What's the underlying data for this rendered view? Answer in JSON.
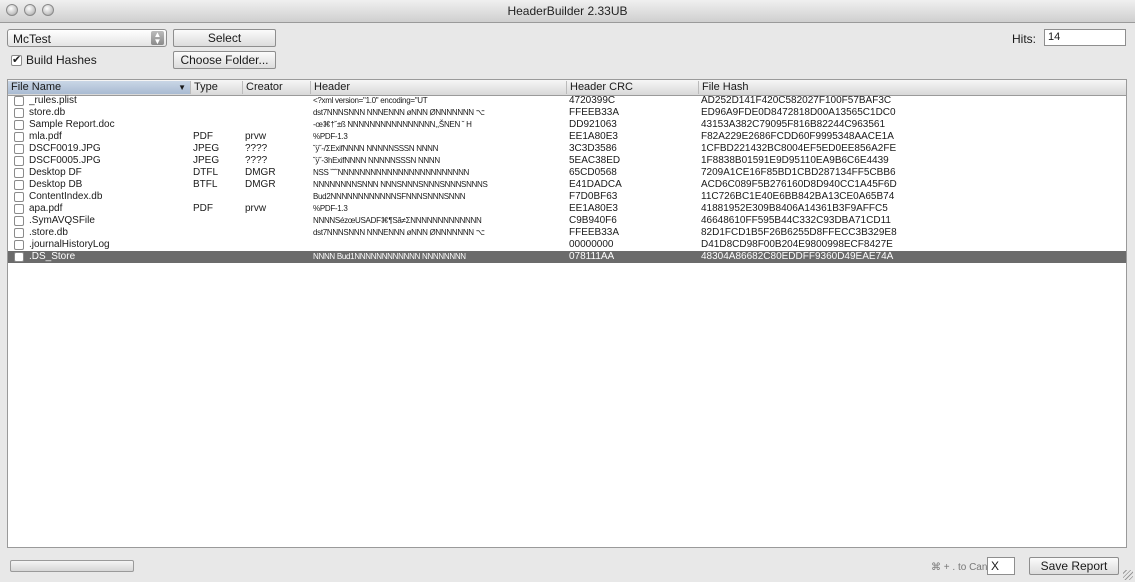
{
  "window": {
    "title": "HeaderBuilder 2.33UB"
  },
  "toolbar": {
    "project_select": "McTest",
    "select_button": "Select",
    "build_hashes_label": "Build Hashes",
    "build_hashes_checked": true,
    "choose_folder_button": "Choose Folder...",
    "hits_label": "Hits:",
    "hits_value": "14"
  },
  "table": {
    "columns": [
      "File Name",
      "Type",
      "Creator",
      "Header",
      "Header CRC",
      "File Hash"
    ],
    "sorted_column": "File Name",
    "rows": [
      {
        "name": "_rules.plist",
        "type": "",
        "creator": "",
        "header": "<?xml version=\"1.0\" encoding=\"UT",
        "crc": "4720399C",
        "hash": "AD252D141F420C582027F100F57BAF3C"
      },
      {
        "name": "store.db",
        "type": "",
        "creator": "",
        "header": "dst7NNNSNNN NNNENNN øNNN ØNNNNNNN ⌥",
        "crc": "FFEEB33A",
        "hash": "ED96A9FDE0D8472818D00A13565C1DC0"
      },
      {
        "name": "Sample Report.doc",
        "type": "",
        "creator": "",
        "header": "-œ⌘†˘±ß NNNNNNNNNNNNNNNN,,ŠNEN ˘ H",
        "crc": "DD921063",
        "hash": "43153A382C79095F816B82244C963561"
      },
      {
        "name": "mla.pdf",
        "type": "PDF",
        "creator": "prvw",
        "header": "%PDF-1.3",
        "crc": "EE1A80E3",
        "hash": "F82A229E2686FCDD60F9995348AACE1A"
      },
      {
        "name": "DSCF0019.JPG",
        "type": "JPEG",
        "creator": "????",
        "header": "˘ÿ˘-/ΣExifNNNN NNNNNSSSN NNNN",
        "crc": "3C3D3586",
        "hash": "1CFBD221432BC8004EF5ED0EE856A2FE"
      },
      {
        "name": "DSCF0005.JPG",
        "type": "JPEG",
        "creator": "????",
        "header": "˘ÿ˘-3hExifNNNN NNNNNSSSN NNNN",
        "crc": "5EAC38ED",
        "hash": "1F8838B01591E9D95110EA9B6C6E4439"
      },
      {
        "name": "Desktop DF",
        "type": "DTFL",
        "creator": "DMGR",
        "header": "NSS ˘˘˘NNNNNNNNNNNNNNNNNNNNNNNN",
        "crc": "65CD0568",
        "hash": "7209A1CE16F85BD1CBD287134FF5CBB6"
      },
      {
        "name": "Desktop DB",
        "type": "BTFL",
        "creator": "DMGR",
        "header": "NNNNNNNNSNNN NNNSNNNSNNNSNNNSNNNS",
        "crc": "E41DADCA",
        "hash": "ACD6C089F5B276160D8D940CC1A45F6D"
      },
      {
        "name": "ContentIndex.db",
        "type": "",
        "creator": "",
        "header": "Bud2NNNNNNNNNNNNSFNNNSNNNSNNN",
        "crc": "F7D0BF63",
        "hash": "11C726BC1E40E6BB842BA13CE0A65B74"
      },
      {
        "name": "apa.pdf",
        "type": "PDF",
        "creator": "prvw",
        "header": "%PDF-1.3",
        "crc": "EE1A80E3",
        "hash": "41881952E309B8406A14361B3F9AFFC5"
      },
      {
        "name": ".SymAVQSFile",
        "type": "",
        "creator": "",
        "header": "NNNNSézœUSADF⌘¶Sã≠ΣNNNNNNNNNNNNN",
        "crc": "C9B940F6",
        "hash": "46648610FF595B44C332C93DBA71CD11"
      },
      {
        "name": ".store.db",
        "type": "",
        "creator": "",
        "header": "dst7NNNSNNN NNNENNN øNNN ØNNNNNNN ⌥",
        "crc": "FFEEB33A",
        "hash": "82D1FCD1B5F26B6255D8FFECC3B329E8"
      },
      {
        "name": ".journalHistoryLog",
        "type": "",
        "creator": "",
        "header": "",
        "crc": "00000000",
        "hash": "D41D8CD98F00B204E9800998ECF8427E"
      },
      {
        "name": ".DS_Store",
        "type": "",
        "creator": "",
        "header": "NNNN Bud1NNNNNNNNNNNN NNNNNNNN",
        "crc": "078111AA",
        "hash": "48304A86682C80EDDFF9360D49EAE74A"
      }
    ],
    "selected_row_index": 13
  },
  "footer": {
    "cancel_hint": "⌘ + . to Cancel",
    "cancel_box_value": "X",
    "save_report_button": "Save Report"
  }
}
